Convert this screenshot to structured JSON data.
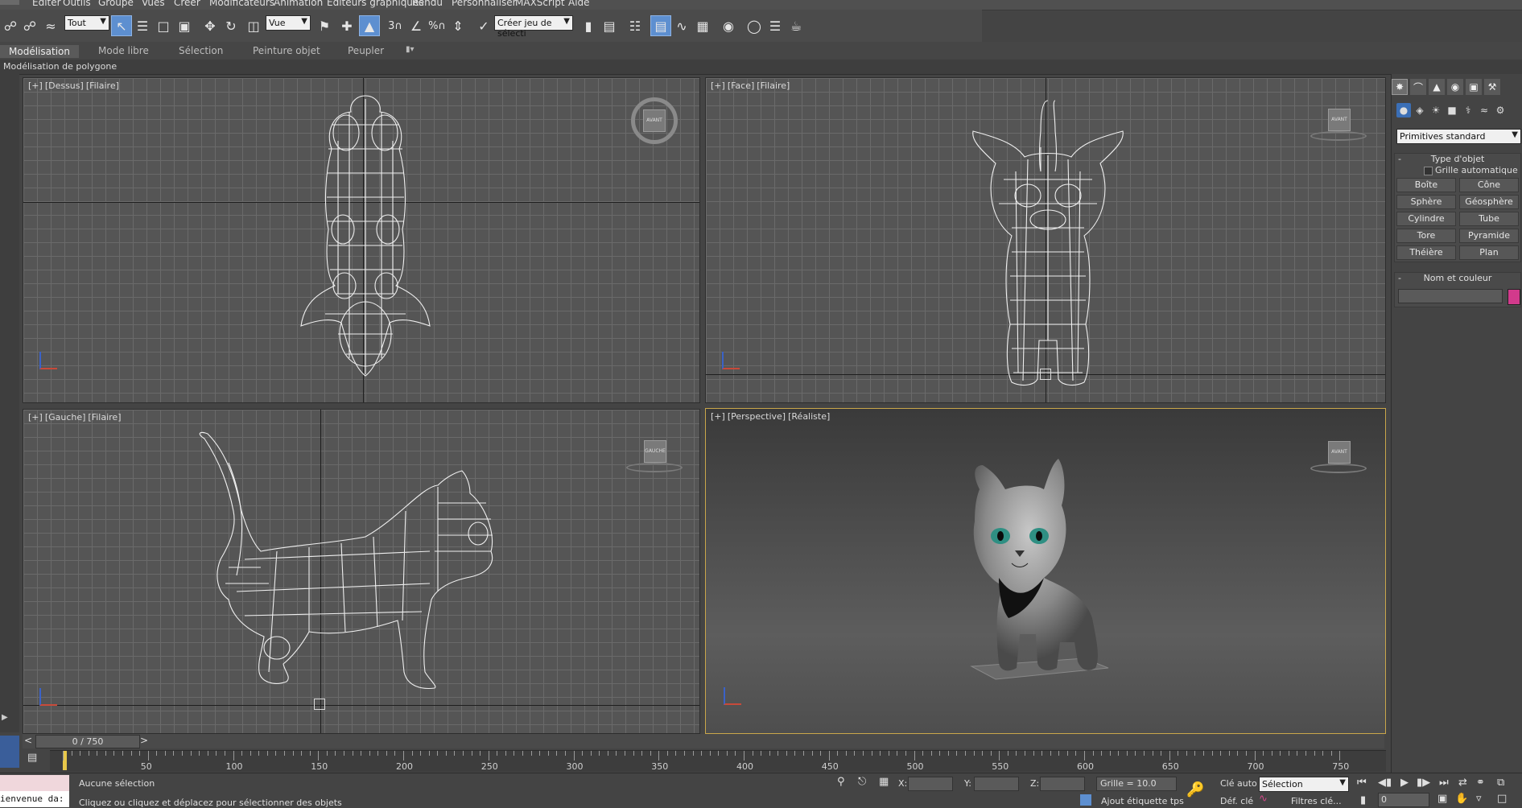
{
  "menu": [
    "Editer",
    "Outils",
    "Groupe",
    "Vues",
    "Créer",
    "Modificateurs",
    "Animation",
    "Editeurs graphiques",
    "Rendu",
    "Personnaliser",
    "MAXScript",
    "Aide"
  ],
  "toolbar": {
    "selection_filter": "Tout",
    "ref_coord": "Vue",
    "named_selection": "Créer jeu de sélecti"
  },
  "ribbon": {
    "tabs": [
      "Modélisation",
      "Mode libre",
      "Sélection",
      "Peinture objet",
      "Peupler"
    ],
    "active_tab": "Modélisation",
    "sub_label": "Modélisation de polygone"
  },
  "viewports": {
    "top": {
      "plus": "[+]",
      "view": "[Dessus]",
      "shade": "[Filaire]"
    },
    "front": {
      "plus": "[+]",
      "view": "[Face]",
      "shade": "[Filaire]"
    },
    "left": {
      "plus": "[+]",
      "view": "[Gauche]",
      "shade": "[Filaire]"
    },
    "persp": {
      "plus": "[+]",
      "view": "[Perspective]",
      "shade": "[Réaliste]"
    }
  },
  "navcube_labels": {
    "top": "AVANT",
    "front": "AVANT",
    "left": "GAUCHE",
    "persp": "AVANT"
  },
  "command_panel": {
    "dropdown": "Primitives standard",
    "object_type_title": "Type d'objet",
    "autogrid_label": "Grille automatique",
    "primitives": [
      "Boîte",
      "Cône",
      "Sphère",
      "Géosphère",
      "Cylindre",
      "Tube",
      "Tore",
      "Pyramide",
      "Théière",
      "Plan"
    ],
    "name_color_title": "Nom et couleur",
    "object_color": "#d23a8c"
  },
  "timeline": {
    "frame_counter": "0 / 750",
    "tick_labels": [
      "50",
      "100",
      "150",
      "200",
      "250",
      "300",
      "350",
      "400",
      "450",
      "500",
      "550",
      "600",
      "650",
      "700",
      "750"
    ]
  },
  "status": {
    "selection_text": "Aucune sélection",
    "prompt_text": "Cliquez ou cliquez et déplacez pour sélectionner des objets",
    "maxscript_text": "ienvenue da:",
    "x_label": "X:",
    "y_label": "Y:",
    "z_label": "Z:",
    "grid_text": "Grille = 10.0",
    "add_tag": "Ajout étiquette tps",
    "auto_key": "Clé auto",
    "set_key": "Déf. clé",
    "key_mode": "Sélection",
    "key_filters": "Filtres clé...",
    "frame": "0"
  }
}
